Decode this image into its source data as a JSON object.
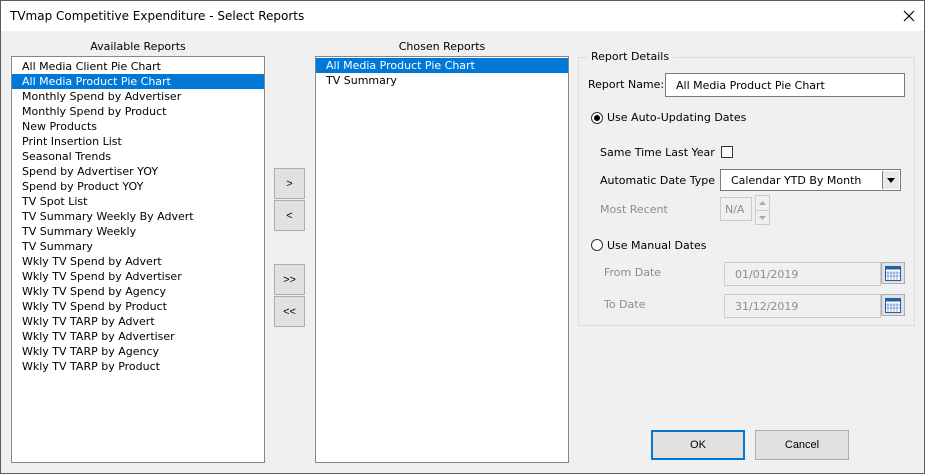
{
  "window": {
    "title": "TVmap Competitive Expenditure - Select Reports",
    "close_icon": "close-icon"
  },
  "available": {
    "caption": "Available Reports",
    "items": [
      "All Media Client Pie Chart",
      "All Media Product Pie Chart",
      "Monthly Spend by Advertiser",
      "Monthly Spend by Product",
      "New Products",
      "Print Insertion List",
      "Seasonal Trends",
      "Spend by Advertiser YOY",
      "Spend by Product YOY",
      "TV Spot List",
      "TV Summary Weekly By Advert",
      "TV Summary Weekly",
      "TV Summary",
      "Wkly TV Spend by Advert",
      "Wkly TV Spend by Advertiser",
      "Wkly TV Spend by Agency",
      "Wkly TV Spend by Product",
      "Wkly TV TARP by Advert",
      "Wkly TV TARP by Advertiser",
      "Wkly TV TARP by Agency",
      "Wkly TV TARP by Product"
    ],
    "selected_index": 1
  },
  "chosen": {
    "caption": "Chosen Reports",
    "items": [
      "All Media Product Pie Chart",
      "TV Summary"
    ],
    "selected_index": 0
  },
  "move_buttons": {
    "add": ">",
    "remove": "<",
    "add_all": ">>",
    "remove_all": "<<"
  },
  "details": {
    "legend": "Report Details",
    "report_name_label": "Report Name:",
    "report_name_value": "All Media Product Pie Chart",
    "auto_dates_label": "Use Auto-Updating Dates",
    "auto_dates_selected": true,
    "same_time_last_year_label": "Same Time Last Year",
    "same_time_last_year_checked": false,
    "auto_date_type_label": "Automatic Date Type",
    "auto_date_type_value": "Calendar YTD By Month",
    "most_recent_label": "Most Recent",
    "most_recent_value": "N/A",
    "manual_dates_label": "Use Manual Dates",
    "manual_dates_selected": false,
    "from_date_label": "From Date",
    "from_date_value": "01/01/2019",
    "to_date_label": "To Date",
    "to_date_value": "31/12/2019"
  },
  "footer": {
    "ok_label": "OK",
    "cancel_label": "Cancel"
  },
  "colors": {
    "selection": "#0078d7",
    "dialog_bg": "#f0f0f0",
    "disabled_text": "#8d8d8d"
  }
}
